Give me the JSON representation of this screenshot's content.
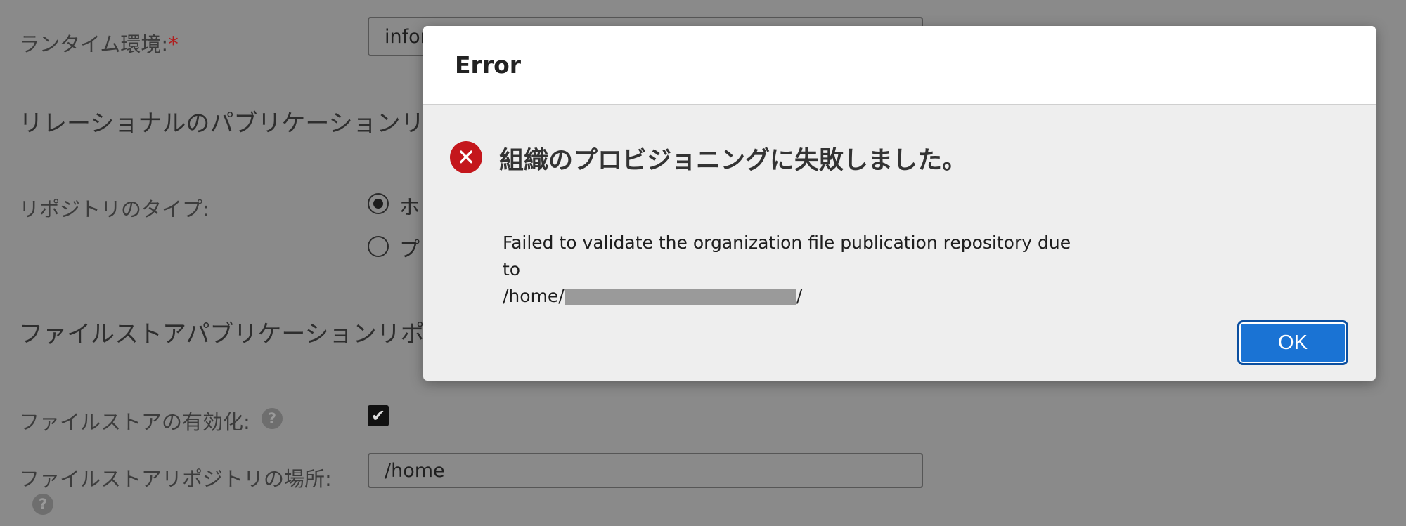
{
  "background": {
    "runtime_label": "ランタイム環境:",
    "required_marker": "*",
    "runtime_value": "infor",
    "relational_section_title": "リレーショナルのパブリケーションリ",
    "repository_type_label": "リポジトリのタイプ:",
    "radio_option_1": "ホ",
    "radio_option_2": "プ",
    "filestore_section_title": "ファイルストアパブリケーションリポ",
    "filestore_enable_label": "ファイルストアの有効化:",
    "filestore_location_label": "ファイルストアリポジトリの場所:",
    "filestore_location_value": "/home"
  },
  "dialog": {
    "title": "Error",
    "heading": "組織のプロビジョニングに失敗しました。",
    "message_line1": "Failed to validate the organization file publication repository due to",
    "message_line2_prefix": "/home/",
    "message_line2_suffix": "/",
    "ok_label": "OK"
  },
  "icons": {
    "error": "error-circle-x-icon",
    "help": "question-circle-icon",
    "check": "checkmark-icon"
  },
  "colors": {
    "overlay_background": "#8a8a8a",
    "error_red": "#c4161c",
    "primary_blue": "#1a73d4"
  }
}
